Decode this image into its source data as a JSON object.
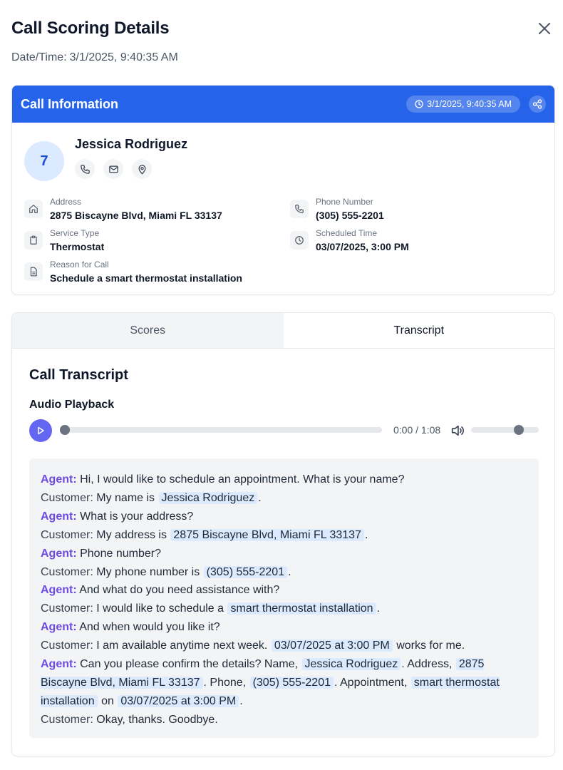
{
  "header": {
    "title": "Call Scoring Details",
    "datetime_label": "Date/Time:",
    "datetime_value": "3/1/2025, 9:40:35 AM"
  },
  "call_info": {
    "title": "Call Information",
    "timestamp_badge": "3/1/2025, 9:40:35 AM",
    "avatar_text": "7",
    "contact_name": "Jessica Rodriguez",
    "fields": {
      "address": {
        "label": "Address",
        "value": "2875 Biscayne Blvd, Miami FL 33137"
      },
      "phone": {
        "label": "Phone Number",
        "value": "(305) 555-2201"
      },
      "service": {
        "label": "Service Type",
        "value": "Thermostat"
      },
      "scheduled": {
        "label": "Scheduled Time",
        "value": "03/07/2025, 3:00 PM"
      },
      "reason": {
        "label": "Reason for Call",
        "value": "Schedule a smart thermostat installation"
      }
    }
  },
  "tabs": {
    "scores": "Scores",
    "transcript": "Transcript",
    "active": "Transcript"
  },
  "transcript": {
    "title": "Call Transcript",
    "audio_label": "Audio Playback",
    "player": {
      "time": "0:00 / 1:08",
      "progress": 0,
      "volume": 0.7
    },
    "lines": [
      {
        "speaker": "Agent:",
        "segments": [
          {
            "t": "Hi, I would like to schedule an appointment. What is your name?",
            "hl": false
          }
        ]
      },
      {
        "speaker": "Customer:",
        "segments": [
          {
            "t": "My name is",
            "hl": false
          },
          {
            "t": "Jessica Rodriguez",
            "hl": true
          },
          {
            "t": ".",
            "hl": false
          }
        ]
      },
      {
        "speaker": "Agent:",
        "segments": [
          {
            "t": "What is your address?",
            "hl": false
          }
        ]
      },
      {
        "speaker": "Customer:",
        "segments": [
          {
            "t": "My address is",
            "hl": false
          },
          {
            "t": "2875 Biscayne Blvd, Miami FL 33137",
            "hl": true
          },
          {
            "t": ".",
            "hl": false
          }
        ]
      },
      {
        "speaker": "Agent:",
        "segments": [
          {
            "t": "Phone number?",
            "hl": false
          }
        ]
      },
      {
        "speaker": "Customer:",
        "segments": [
          {
            "t": "My phone number is",
            "hl": false
          },
          {
            "t": "(305) 555-2201",
            "hl": true
          },
          {
            "t": ".",
            "hl": false
          }
        ]
      },
      {
        "speaker": "Agent:",
        "segments": [
          {
            "t": "And what do you need assistance with?",
            "hl": false
          }
        ]
      },
      {
        "speaker": "Customer:",
        "segments": [
          {
            "t": "I would like to schedule a",
            "hl": false
          },
          {
            "t": "smart thermostat installation",
            "hl": true
          },
          {
            "t": ".",
            "hl": false
          }
        ]
      },
      {
        "speaker": "Agent:",
        "segments": [
          {
            "t": "And when would you like it?",
            "hl": false
          }
        ]
      },
      {
        "speaker": "Customer:",
        "segments": [
          {
            "t": "I am available anytime next week.",
            "hl": false
          },
          {
            "t": "03/07/2025 at 3:00 PM",
            "hl": true
          },
          {
            "t": "works for me.",
            "hl": false
          }
        ]
      },
      {
        "speaker": "Agent:",
        "segments": [
          {
            "t": "Can you please confirm the details? Name,",
            "hl": false
          },
          {
            "t": "Jessica Rodriguez",
            "hl": true
          },
          {
            "t": ". Address,",
            "hl": false
          },
          {
            "t": "2875 Biscayne Blvd, Miami FL 33137",
            "hl": true
          },
          {
            "t": ". Phone,",
            "hl": false
          },
          {
            "t": "(305) 555-2201",
            "hl": true
          },
          {
            "t": ". Appointment,",
            "hl": false
          },
          {
            "t": "smart thermostat installation",
            "hl": true
          },
          {
            "t": "on",
            "hl": false
          },
          {
            "t": "03/07/2025 at 3:00 PM",
            "hl": true
          },
          {
            "t": ".",
            "hl": false
          }
        ]
      },
      {
        "speaker": "Customer:",
        "segments": [
          {
            "t": "Okay, thanks. Goodbye.",
            "hl": false
          }
        ]
      }
    ]
  },
  "colors": {
    "header_blue": "#2563eb",
    "agent_purple": "#6d4ae0",
    "highlight_bg": "#dbeafe",
    "play_button": "#6366f1"
  }
}
